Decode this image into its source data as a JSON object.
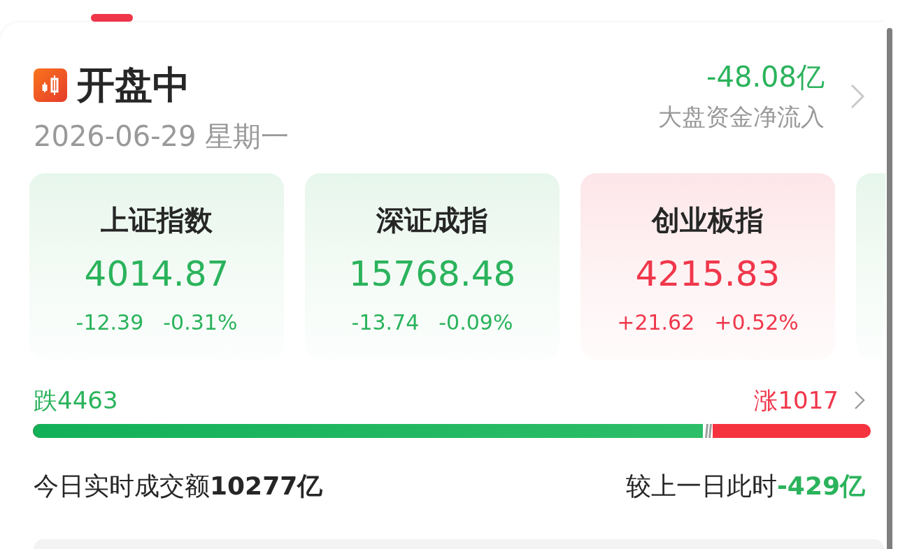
{
  "header": {
    "status": "开盘中",
    "date": "2026-06-29 星期一",
    "fund_flow": {
      "value": "-48.08亿",
      "rising": false,
      "label": "大盘资金净流入"
    }
  },
  "indices": [
    {
      "name": "上证指数",
      "value": "4014.87",
      "change": "-12.39",
      "change_pct": "-0.31%",
      "rising": false
    },
    {
      "name": "深证成指",
      "value": "15768.48",
      "change": "-13.74",
      "change_pct": "-0.09%",
      "rising": false
    },
    {
      "name": "创业板指",
      "value": "4215.83",
      "change": "+21.62",
      "change_pct": "+0.52%",
      "rising": true
    },
    {
      "rising": false
    }
  ],
  "breadth": {
    "decline": "跌4463",
    "advance": "涨1017",
    "level": 0.8
  },
  "turnover": {
    "label": "今日实时成交额",
    "value": "10277亿",
    "compare_label": "较上一日此时",
    "compare_value": "-429亿",
    "compare_rising": false
  }
}
